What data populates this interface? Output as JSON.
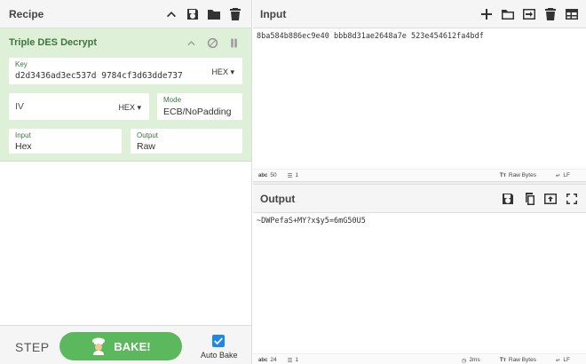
{
  "recipe": {
    "title": "Recipe",
    "operation": {
      "name": "Triple DES Decrypt",
      "key": {
        "label": "Key",
        "value": "d2d3436ad3ec537d 9784cf3d63dde737",
        "type": "HEX"
      },
      "iv": {
        "placeholder": "IV",
        "type": "HEX"
      },
      "mode": {
        "label": "Mode",
        "value": "ECB/NoPadding"
      },
      "input": {
        "label": "Input",
        "value": "Hex"
      },
      "output": {
        "label": "Output",
        "value": "Raw"
      }
    },
    "step_label": "STEP",
    "bake_label": "BAKE!",
    "auto_bake_label": "Auto Bake"
  },
  "input": {
    "title": "Input",
    "text": "8ba584b886ec9e40 bbb8d31ae2648a7e 523e454612fa4bdf",
    "status": {
      "chars": "50",
      "lines": "1",
      "format": "Raw Bytes",
      "eol": "LF"
    }
  },
  "output": {
    "title": "Output",
    "text": "~DWPefaS+MY?x$y5=6mG50U5",
    "status": {
      "chars": "24",
      "lines": "1",
      "time": "2ms",
      "format": "Raw Bytes",
      "eol": "LF"
    }
  }
}
